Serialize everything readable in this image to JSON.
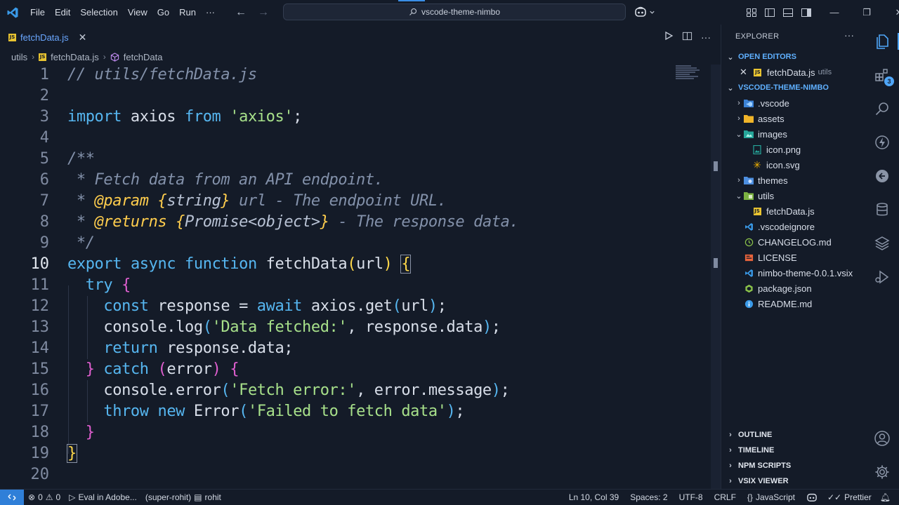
{
  "menu": [
    "File",
    "Edit",
    "Selection",
    "View",
    "Go",
    "Run",
    "···"
  ],
  "command_center": {
    "text": "vscode-theme-nimbo"
  },
  "tab": {
    "label": "fetchData.js",
    "icon": "js-file-icon"
  },
  "breadcrumbs": [
    "utils",
    "fetchData.js",
    "fetchData"
  ],
  "editor": {
    "active_line": 10,
    "line_numbers": [
      "1",
      "2",
      "3",
      "4",
      "5",
      "6",
      "7",
      "8",
      "9",
      "10",
      "11",
      "12",
      "13",
      "14",
      "15",
      "16",
      "17",
      "18",
      "19",
      "20"
    ]
  },
  "sidebar": {
    "title": "EXPLORER",
    "open_editors_title": "OPEN EDITORS",
    "open_editor": {
      "name": "fetchData.js",
      "folder": "utils"
    },
    "project_title": "VSCODE-THEME-NIMBO",
    "tree": [
      {
        "name": ".vscode",
        "kind": "folder",
        "expanded": false,
        "icon": "vscode-folder-icon",
        "depth": 0
      },
      {
        "name": "assets",
        "kind": "folder",
        "expanded": false,
        "icon": "folder-icon",
        "depth": 0
      },
      {
        "name": "images",
        "kind": "folder",
        "expanded": true,
        "icon": "images-folder-icon",
        "depth": 0
      },
      {
        "name": "icon.png",
        "kind": "file",
        "icon": "image-file-icon",
        "depth": 1
      },
      {
        "name": "icon.svg",
        "kind": "file",
        "icon": "svg-file-icon",
        "depth": 1
      },
      {
        "name": "themes",
        "kind": "folder",
        "expanded": false,
        "icon": "themes-folder-icon",
        "depth": 0
      },
      {
        "name": "utils",
        "kind": "folder",
        "expanded": true,
        "icon": "utils-folder-icon",
        "depth": 0
      },
      {
        "name": "fetchData.js",
        "kind": "file",
        "icon": "js-file-icon",
        "depth": 1
      },
      {
        "name": ".vscodeignore",
        "kind": "file",
        "icon": "vscode-file-icon",
        "depth": 0
      },
      {
        "name": "CHANGELOG.md",
        "kind": "file",
        "icon": "changelog-icon",
        "depth": 0
      },
      {
        "name": "LICENSE",
        "kind": "file",
        "icon": "license-icon",
        "depth": 0
      },
      {
        "name": "nimbo-theme-0.0.1.vsix",
        "kind": "file",
        "icon": "vsix-file-icon",
        "depth": 0
      },
      {
        "name": "package.json",
        "kind": "file",
        "icon": "npm-file-icon",
        "depth": 0
      },
      {
        "name": "README.md",
        "kind": "file",
        "icon": "info-file-icon",
        "depth": 0
      }
    ],
    "collapsed_sections": [
      "OUTLINE",
      "TIMELINE",
      "NPM SCRIPTS",
      "VSIX VIEWER"
    ]
  },
  "activity_bar": {
    "extensions_badge": "3"
  },
  "statusbar": {
    "errors": "0",
    "warnings": "0",
    "run_label": "Eval in Adobe...",
    "profile": "(super-rohit)",
    "user": "rohit",
    "cursor": "Ln 10, Col 39",
    "spaces": "Spaces: 2",
    "encoding": "UTF-8",
    "eol": "CRLF",
    "language": "JavaScript",
    "formatter": "Prettier"
  },
  "colors": {
    "accent": "#4fa6f8",
    "background": "#141b28",
    "keyword": "#56b6f0",
    "string": "#a7e08a",
    "comment": "#8391aa"
  }
}
